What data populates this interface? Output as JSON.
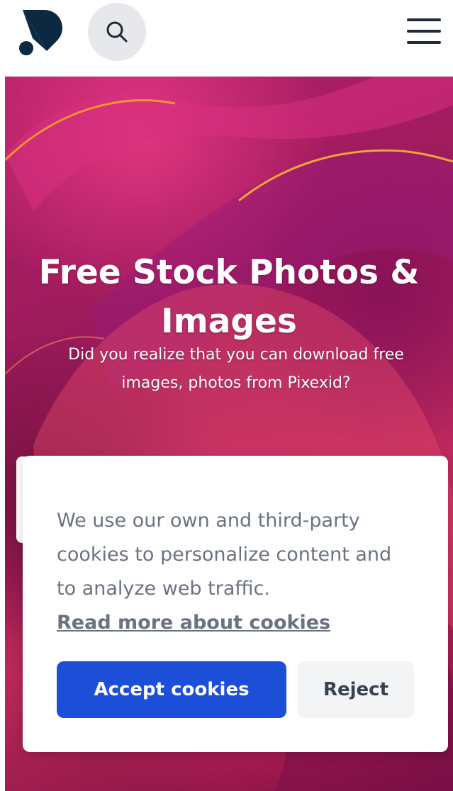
{
  "header": {
    "logo_icon": "brand-logo-icon",
    "search_icon": "search-icon",
    "menu_icon": "hamburger-menu-icon"
  },
  "hero": {
    "title_line1": "Free Stock Photos &",
    "title_line2": "Images",
    "subtitle_line1": "Did you realize that you can download free",
    "subtitle_line2": "images, photos from Pixexid?"
  },
  "cookie_banner": {
    "text_line1": "We use our own and third-party",
    "text_line2": "cookies to personalize content and",
    "text_line3": "to analyze web traffic.",
    "read_more_label": "Read more about cookies",
    "accept_label": "Accept cookies",
    "reject_label": "Reject"
  },
  "colors": {
    "brand_dark": "#0b2a42",
    "accept_blue": "#1d4ed8",
    "hero_magenta": "#b4206a"
  }
}
